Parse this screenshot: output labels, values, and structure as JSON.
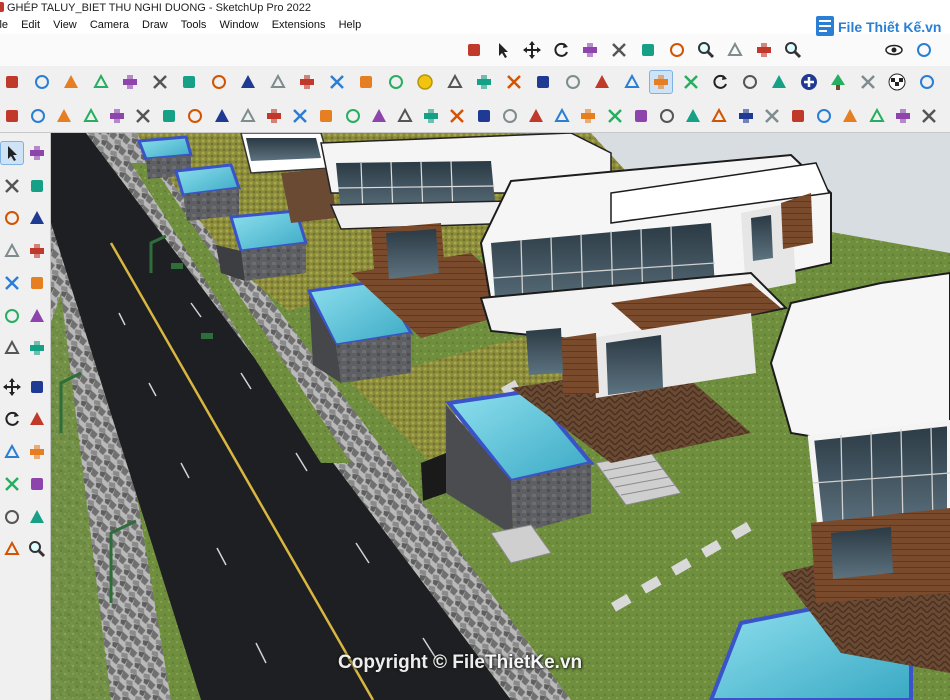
{
  "window": {
    "title": "GHÉP TALUY_BIET THU NGHI DUONG - SketchUp Pro 2022"
  },
  "menu": [
    "ile",
    "Edit",
    "View",
    "Camera",
    "Draw",
    "Tools",
    "Window",
    "Extensions",
    "Help"
  ],
  "watermark": {
    "logo_text": "File Thiết Kế.vn",
    "copyright": "Copyright © FileThietKe.vn"
  },
  "colors": {
    "toolbar_bg": "#f0f0f0",
    "viewport_sky": "#cfd6dc",
    "road": "#1e1f22",
    "lane_line": "#d8b640",
    "grass": "#6f8f3e",
    "pool": "#5fc3d8",
    "wood": "#7a4a2c"
  },
  "toolbars": {
    "row1": [
      "line-icon",
      "select-icon",
      "move-icon",
      "rotate-icon",
      "scale-icon",
      "instructor-icon",
      "push-pull-icon",
      "paint-icon",
      "zoom-icon",
      "zoom-window-icon",
      "zoom-extents-icon",
      "search-icon",
      "eye-icon",
      "footprints-icon"
    ],
    "row2": [
      "sandbox-icon",
      "sandbox-icon",
      "sandbox-icon",
      "sandbox-icon",
      "sandbox-icon",
      "sandbox-icon",
      "section-icon",
      "section-icon",
      "section-icon",
      "section-icon",
      "section-icon",
      "section-icon",
      "section-icon",
      "section-icon",
      "gold-coin-icon",
      "tools-icon",
      "style-icon",
      "style-icon",
      "style-icon",
      "style-icon",
      "style-icon",
      "shaded-icon",
      "textured-icon",
      "layer-icon",
      "refresh-icon",
      "camera-icon",
      "arrows-icon",
      "add-icon",
      "tree-icon",
      "chart-icon",
      "checker-icon",
      "globe-icon"
    ],
    "row3_count": 36,
    "left_count": 26
  }
}
